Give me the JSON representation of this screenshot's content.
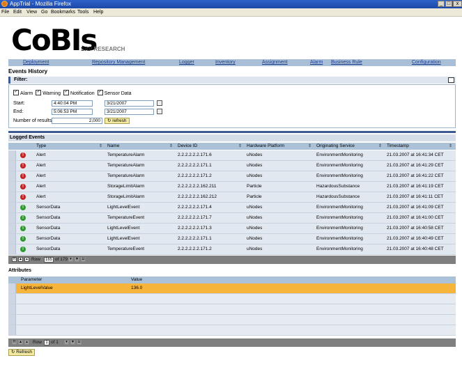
{
  "window": {
    "title": "AppTrial - Mozilla Firefox",
    "controls": [
      "_",
      "□",
      "x"
    ]
  },
  "menu": [
    "File",
    "Edit",
    "View",
    "Go",
    "Bookmarks",
    "Tools",
    "Help"
  ],
  "brand": {
    "logo": "CoBIs",
    "sub_bold": "SAP",
    "sub": "RESEARCH"
  },
  "nav": [
    "Deployment",
    "Repository Management",
    "Logger",
    "Inventory",
    "Assignment",
    "Alarm",
    "Business Rule",
    "Configuration"
  ],
  "page_title": "Events History",
  "filter": {
    "title": "Filter:",
    "checkboxes": [
      {
        "label": "Alarm",
        "checked": true
      },
      {
        "label": "Warning",
        "checked": true
      },
      {
        "label": "Notification",
        "checked": true
      },
      {
        "label": "Sensor Data",
        "checked": true
      }
    ],
    "start_label": "Start:",
    "start_time": "4:40:04 PM",
    "start_date": "3/21/2007",
    "end_label": "End:",
    "end_time": "5:06:53 PM",
    "end_date": "3/21/2007",
    "results_label": "Number of results:",
    "results_value": "2,000",
    "refresh_label": "refresh"
  },
  "logged": {
    "title": "Logged Events",
    "columns": [
      "Type",
      "Name",
      "Device ID",
      "Hardware Platform",
      "Originating Service",
      "Timestamp"
    ],
    "rows": [
      {
        "status": "alert",
        "cells": [
          "Alert",
          "TemperatureAlarm",
          "2.2.2.2.2.2.171.6",
          "uNodes",
          "EnvironmentMonitoring",
          "21.03.2007 at 16:41:34 CET"
        ]
      },
      {
        "status": "alert",
        "cells": [
          "Alert",
          "TemperatureAlarm",
          "2.2.2.2.2.2.171.1",
          "uNodes",
          "EnvironmentMonitoring",
          "21.03.2007 at 16:41:29 CET"
        ]
      },
      {
        "status": "alert",
        "cells": [
          "Alert",
          "TemperatureAlarm",
          "2.2.2.2.2.2.171.2",
          "uNodes",
          "EnvironmentMonitoring",
          "21.03.2007 at 16:41:22 CET"
        ]
      },
      {
        "status": "alert",
        "cells": [
          "Alert",
          "StorageLimitAlarm",
          "2.2.2.2.2.2.162.211",
          "Particle",
          "HazardousSubstance",
          "21.03.2007 at 16:41:19 CET"
        ]
      },
      {
        "status": "alert",
        "cells": [
          "Alert",
          "StorageLimitAlarm",
          "2.2.2.2.2.2.162.212",
          "Particle",
          "HazardousSubstance",
          "21.03.2007 at 16:41:11 CET"
        ]
      },
      {
        "status": "ok",
        "cells": [
          "SensorData",
          "LightLevelEvent",
          "2.2.2.2.2.2.171.4",
          "uNodes",
          "EnvironmentMonitoring",
          "21.03.2007 at 16:41:09 CET"
        ]
      },
      {
        "status": "ok",
        "cells": [
          "SensorData",
          "TemperatureEvent",
          "2.2.2.2.2.2.171.7",
          "uNodes",
          "EnvironmentMonitoring",
          "21.03.2007 at 16:41:00 CET"
        ]
      },
      {
        "status": "ok",
        "cells": [
          "SensorData",
          "LightLevelEvent",
          "2.2.2.2.2.2.171.3",
          "uNodes",
          "EnvironmentMonitoring",
          "21.03.2007 at 16:40:58 CET"
        ]
      },
      {
        "status": "ok",
        "cells": [
          "SensorData",
          "LightLevelEvent",
          "2.2.2.2.2.2.171.1",
          "uNodes",
          "EnvironmentMonitoring",
          "21.03.2007 at 16:40:49 CET"
        ]
      },
      {
        "status": "ok",
        "cells": [
          "SensorData",
          "TemperatureEvent",
          "2.2.2.2.2.2.171.2",
          "uNodes",
          "EnvironmentMonitoring",
          "21.03.2007 at 16:40:48 CET"
        ]
      }
    ],
    "pager": {
      "row_label": "Row",
      "row_value": "165",
      "of_label": "of 179"
    }
  },
  "attributes": {
    "title": "Attributes",
    "columns": [
      "Parameter",
      "Value"
    ],
    "rows": [
      {
        "cells": [
          "LightLevelValue",
          "136.0"
        ]
      }
    ],
    "pager": {
      "row_label": "Row",
      "row_value": "1",
      "of_label": "of 1"
    }
  },
  "refresh_label": "Refresh",
  "colors": {
    "accent": "#3b5b92",
    "header": "#abc1d8",
    "row": "#e2e8f0",
    "highlight": "#f7b43a",
    "alert": "#c62222",
    "ok": "#2e9a2e"
  }
}
